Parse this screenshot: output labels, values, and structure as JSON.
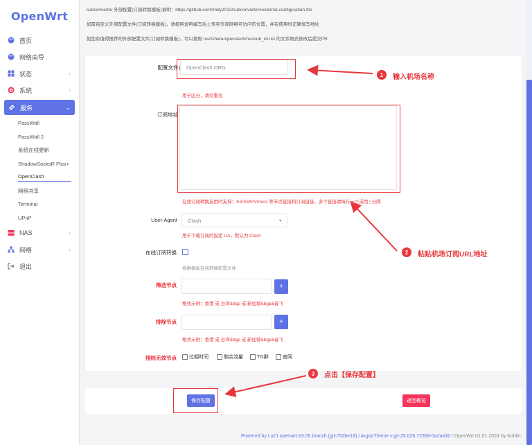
{
  "app": {
    "logo": "OpenWrt"
  },
  "sidebar": {
    "items": [
      {
        "label": "首页",
        "icon": "palette-icon"
      },
      {
        "label": "网络向导",
        "icon": "palette-icon"
      },
      {
        "label": "状态",
        "icon": "grid-icon"
      },
      {
        "label": "系统",
        "icon": "gear-icon"
      },
      {
        "label": "服务",
        "icon": "link-icon",
        "active": true
      },
      {
        "label": "NAS",
        "icon": "storage-icon"
      },
      {
        "label": "网络",
        "icon": "network-icon"
      },
      {
        "label": "退出",
        "icon": "logout-icon"
      }
    ],
    "services_sub": [
      "PassWall",
      "PassWall 2",
      "系统在线更新",
      "ShadowSocksR Plus+",
      "OpenClash",
      "网络共享",
      "Terminal",
      "UPnP"
    ]
  },
  "notes": [
    "subconverter 外部配置(订阅转换模板)说明：https://github.com/tindy2013/subconverter#external-configuration-file",
    "如需自定义外部配置文件(订阅转换模板)，请按照说明编写后上传至外部网络可访问的位置，并在使用时正确填写地址",
    "如您有值得推荐的外部配置文件(订阅转换模板)，可以按照 /usr/share/openclash/res/sub_ini.list 的文件格式修改后提交PR"
  ],
  "form": {
    "config_name_label": "配置文件名",
    "config_name_placeholder": "OpenClash.ORG",
    "config_name_hint": "用于区分，请勿重名",
    "sub_url_label": "订阅地址",
    "sub_url_hint": "在线订阅转换启用时支持：SS/SSR/Vmess 等节点链接和订阅链接，多个链接请每行一个或用 | 分隔",
    "ua_label": "User-Agent",
    "ua_value": "Clash",
    "ua_hint": "用于下载订阅的指定 UA，默认为 Clash",
    "online_convert_label": "在线订阅转换",
    "online_convert_hint": "根据模板在线转换配置文件",
    "filter_label": "筛选节点",
    "filter_hint": "格式示例：香港 或 台湾&bgp 或 新加坡&bgp&音飞",
    "exclude_label": "排除节点",
    "exclude_hint": "格式示例：香港 或 台湾&bgp 或 新加坡&bgp&音飞",
    "exclude_invalid_label": "排除无效节点",
    "exclude_options": [
      "过期时间",
      "剩余流量",
      "TG群",
      "官网"
    ],
    "plus": "+"
  },
  "annotations": {
    "step1": {
      "num": "1",
      "text": "输入机场名称"
    },
    "step2": {
      "num": "2",
      "text": "粘贴机场订阅URL地址"
    },
    "step3": {
      "num": "3",
      "text": "点击【保存配置】"
    }
  },
  "buttons": {
    "save": "保存配置",
    "back": "返回概览"
  },
  "footer": {
    "left": "Powered by LuCI openwrt-23.05 branch (git-752be18) / ArgonTheme v.git-25.026.72358-0a2aa30",
    "right": "/ OpenWrt 02.01.2024 by Kiddin'"
  },
  "colors": {
    "accent": "#5e72e4",
    "danger": "#e8373c",
    "back_button": "#f5365c"
  }
}
